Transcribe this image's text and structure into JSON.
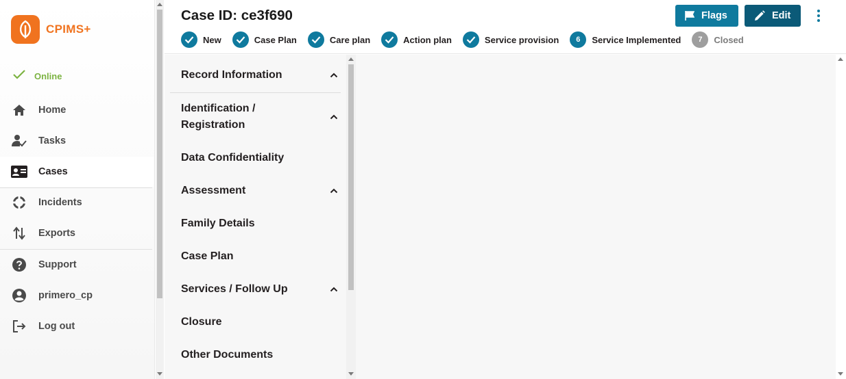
{
  "app": {
    "logo_text": "CPIMS+"
  },
  "status": {
    "online_label": "Online",
    "online_color": "#7cb342"
  },
  "nav": {
    "items": [
      {
        "label": "Home",
        "icon": "home-icon"
      },
      {
        "label": "Tasks",
        "icon": "tasks-icon"
      },
      {
        "label": "Cases",
        "icon": "cases-icon",
        "active": true
      },
      {
        "label": "Incidents",
        "icon": "incidents-icon"
      },
      {
        "label": "Exports",
        "icon": "exports-icon"
      },
      {
        "label": "Support",
        "icon": "help-icon"
      },
      {
        "label": "primero_cp",
        "icon": "account-icon"
      },
      {
        "label": "Log out",
        "icon": "logout-icon"
      }
    ]
  },
  "header": {
    "case_id": "Case ID: ce3f690",
    "flags_label": "Flags",
    "edit_label": "Edit"
  },
  "workflow": {
    "steps": [
      {
        "label": "New",
        "state": "done"
      },
      {
        "label": "Case Plan",
        "state": "done"
      },
      {
        "label": "Care plan",
        "state": "done"
      },
      {
        "label": "Action plan",
        "state": "done"
      },
      {
        "label": "Service provision",
        "state": "done"
      },
      {
        "label": "Service Implemented",
        "state": "current",
        "number": "6"
      },
      {
        "label": "Closed",
        "state": "pending",
        "number": "7"
      }
    ]
  },
  "forms": {
    "items": [
      {
        "label": "Record Information",
        "expandable": true
      },
      {
        "label": "Identification / Registration",
        "expandable": true
      },
      {
        "label": "Data Confidentiality",
        "expandable": false
      },
      {
        "label": "Assessment",
        "expandable": true
      },
      {
        "label": "Family Details",
        "expandable": false
      },
      {
        "label": "Case Plan",
        "expandable": false
      },
      {
        "label": "Services / Follow Up",
        "expandable": true
      },
      {
        "label": "Closure",
        "expandable": false
      },
      {
        "label": "Other Documents",
        "expandable": false
      }
    ]
  },
  "colors": {
    "brand": "#f0731f",
    "primary": "#0f7a9e",
    "primary_dark": "#0b5a78",
    "pending": "#9e9e9e"
  }
}
